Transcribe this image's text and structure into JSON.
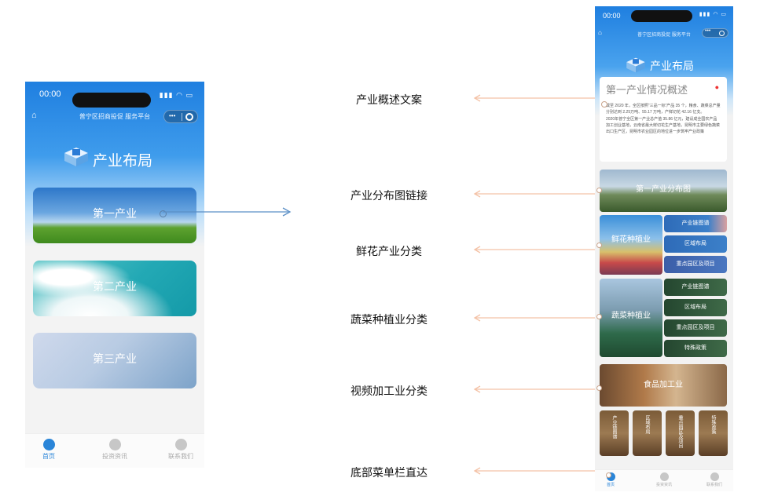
{
  "left_phone": {
    "status_time": "00:00",
    "nav_title": "普宁区招商投促 服务平台",
    "page_title": "产业布局",
    "cards": [
      "第一产业",
      "第二产业",
      "第三产业"
    ],
    "tabs": [
      "首页",
      "投资资讯",
      "联系我们"
    ]
  },
  "annotations": [
    "产业概述文案",
    "产业分布图链接",
    "鲜花产业分类",
    "蔬菜种植业分类",
    "视频加工业分类",
    "底部菜单栏直达"
  ],
  "right_phone": {
    "status_time": "00:00",
    "nav_title": "普宁区招商投促 服务平台",
    "page_title": "产业布局",
    "overview_title": "第一产业情况概述",
    "overview_text_1": "截至 2020 年，全区按照“三品一标”产品 35 个，粮食、蔬菜总产量分别达到 2.25万吨、55.17 万吨，产鲜切花 42.16 亿支。",
    "overview_text_2": "2020年普宁全区第一产业总产值 35.86 亿元，建设成全国农产品加工创业基地，云南省最大鲜切花生产基地，昆明市主要绿色蔬菜出口生产区，昆明市农业园区的地位进一步筑牢产业政策",
    "map_label": "第一产业分布图",
    "flower_label": "鲜花种植业",
    "flower_subs": [
      "产业链图谱",
      "区域布局",
      "重点园区及项目"
    ],
    "veg_label": "蔬菜种植业",
    "veg_subs": [
      "产业链图谱",
      "区域布局",
      "重点园区及项目",
      "特殊政策"
    ],
    "food_label": "食品加工业",
    "food_subs": [
      "产业链图谱",
      "区域布局",
      "重点园区及项目",
      "特殊政策"
    ],
    "tabs": [
      "首页",
      "投资资讯",
      "联系我们"
    ]
  },
  "colors": {
    "accent_blue": "#1f7fe0",
    "pointer_line": "#f4c2a6",
    "arrow_blue": "#5b8fc6"
  }
}
